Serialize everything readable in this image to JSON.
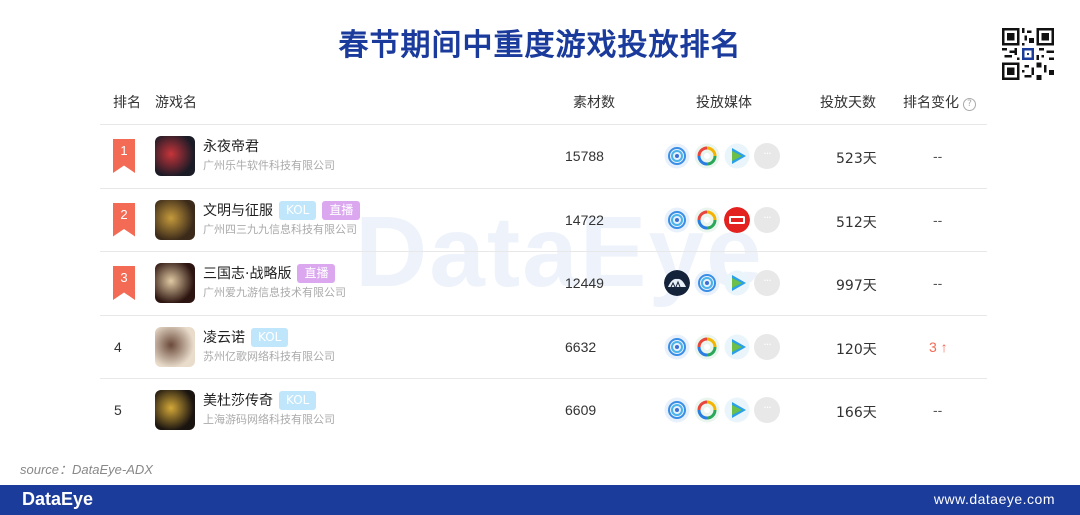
{
  "title": "春节期间中重度游戏投放排名",
  "watermark": "DataEye",
  "headers": {
    "rank": "排名",
    "name": "游戏名",
    "materials": "素材数",
    "media": "投放媒体",
    "days": "投放天数",
    "change": "排名变化",
    "help_icon": "?"
  },
  "rows": [
    {
      "rank": "1",
      "name": "永夜帝君",
      "company": "广州乐牛软件科技有限公司",
      "tags": [],
      "materials": "15788",
      "media": [
        "media-a-icon",
        "media-b-icon",
        "media-c-icon",
        "more-icon"
      ],
      "days": "523天",
      "change": "--",
      "icon_colors": [
        "#1b1b26",
        "#c7343a"
      ]
    },
    {
      "rank": "2",
      "name": "文明与征服",
      "company": "广州四三九九信息科技有限公司",
      "tags": [
        "KOL",
        "直播"
      ],
      "materials": "14722",
      "media": [
        "media-a-icon",
        "media-b-icon",
        "media-d-icon",
        "more-icon"
      ],
      "days": "512天",
      "change": "--",
      "icon_colors": [
        "#3b2a1a",
        "#c59a3c"
      ]
    },
    {
      "rank": "3",
      "name": "三国志·战略版",
      "company": "广州爱九游信息技术有限公司",
      "tags": [
        "直播"
      ],
      "materials": "12449",
      "media": [
        "media-e-icon",
        "media-a-icon",
        "media-c-icon",
        "more-icon"
      ],
      "days": "997天",
      "change": "--",
      "icon_colors": [
        "#2c1410",
        "#e0c9a2"
      ]
    },
    {
      "rank": "4",
      "name": "凌云诺",
      "company": "苏州亿歌网络科技有限公司",
      "tags": [
        "KOL"
      ],
      "materials": "6632",
      "media": [
        "media-a-icon",
        "media-b-icon",
        "media-c-icon",
        "more-icon"
      ],
      "days": "120天",
      "change": "3 ↑",
      "icon_colors": [
        "#e9dccb",
        "#6b4a3a"
      ]
    },
    {
      "rank": "5",
      "name": "美杜莎传奇",
      "company": "上海游码网络科技有限公司",
      "tags": [
        "KOL"
      ],
      "materials": "6609",
      "media": [
        "media-a-icon",
        "media-b-icon",
        "media-c-icon",
        "more-icon"
      ],
      "days": "166天",
      "change": "--",
      "icon_colors": [
        "#1a1410",
        "#d4a838"
      ]
    }
  ],
  "more_label": "···",
  "source": "source：DataEye-ADX",
  "footer": {
    "logo": "DataEye",
    "url": "www.dataeye.com"
  },
  "colors": {
    "title": "#1a3a9c",
    "ribbon": "#f36b55",
    "footer": "#1b3c9b",
    "kol_tag": "#bfe6fb",
    "live_tag": "#dba8f0",
    "rank_up": "#f36b55"
  }
}
